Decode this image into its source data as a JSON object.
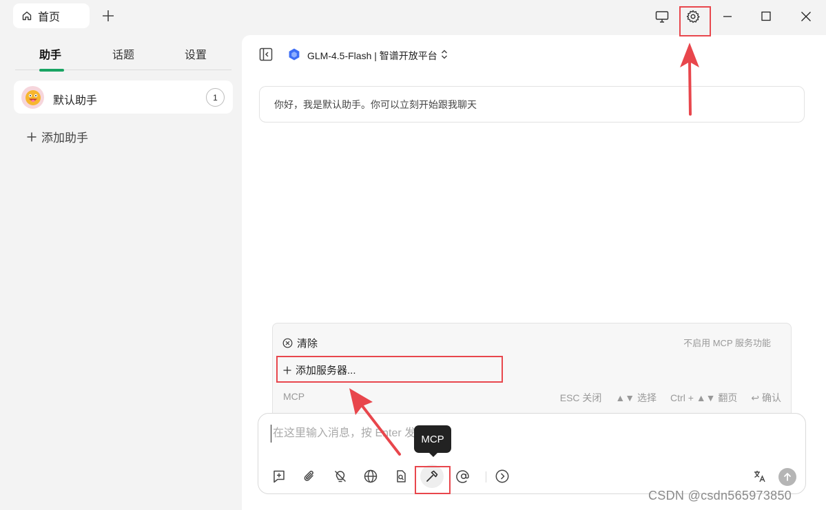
{
  "titlebar": {
    "home_tab_label": "首页",
    "icons": [
      "home-icon",
      "plus-icon",
      "monitor-icon",
      "gear-icon",
      "minimize-icon",
      "maximize-icon",
      "close-icon"
    ]
  },
  "sidebar": {
    "tabs": [
      {
        "label": "助手",
        "active": true
      },
      {
        "label": "话题",
        "active": false
      },
      {
        "label": "设置",
        "active": false
      }
    ],
    "assistant": {
      "name": "默认助手",
      "count": "1"
    },
    "add_assistant_label": "添加助手"
  },
  "main": {
    "model_name": "GLM-4.5-Flash | 智谱开放平台",
    "greeting": "你好，我是默认助手。你可以立刻开始跟我聊天"
  },
  "mcp_menu": {
    "clear_label": "清除",
    "disabled_hint": "不启用 MCP 服务功能",
    "add_server_label": "添加服务器...",
    "section_label": "MCP",
    "hints": [
      "ESC 关闭",
      "▲▼ 选择",
      "Ctrl + ▲▼ 翻页",
      "↩ 确认"
    ]
  },
  "input": {
    "placeholder": "在这里输入消息，按 Enter 发送"
  },
  "toolbar_icons": [
    "new-topic-icon",
    "attachment-icon",
    "lightbulb-off-icon",
    "globe-icon",
    "knowledge-icon",
    "mcp-hammer-icon",
    "mention-icon",
    "more-icon",
    "translate-icon",
    "send-icon"
  ],
  "tooltip": {
    "label": "MCP"
  },
  "watermark": "CSDN @csdn565973850",
  "colors": {
    "accent_green": "#19a463",
    "annotation_red": "#e8464c"
  }
}
